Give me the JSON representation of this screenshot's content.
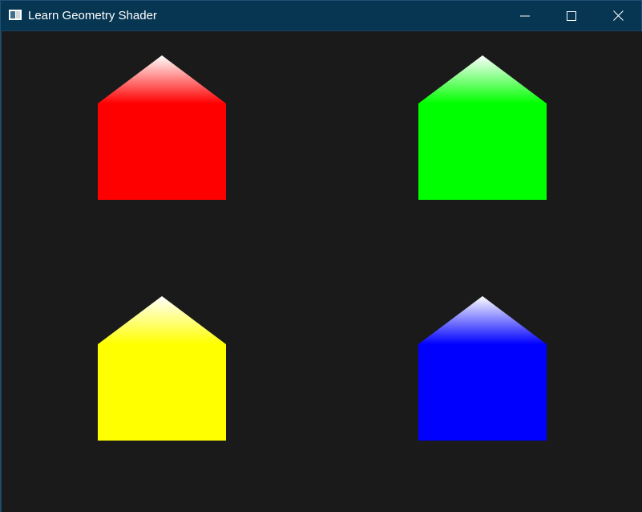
{
  "window": {
    "title": "Learn Geometry Shader",
    "controls": {
      "minimize_icon": "minimize-icon",
      "maximize_icon": "maximize-icon",
      "close_icon": "close-icon"
    }
  },
  "scene": {
    "background": "#1a1a1a",
    "houses": [
      {
        "name": "red-house",
        "color": "#ff0000"
      },
      {
        "name": "green-house",
        "color": "#00ff00"
      },
      {
        "name": "yellow-house",
        "color": "#ffff00"
      },
      {
        "name": "blue-house",
        "color": "#0000ff"
      }
    ],
    "roof_tip_color": "#ffffff"
  }
}
